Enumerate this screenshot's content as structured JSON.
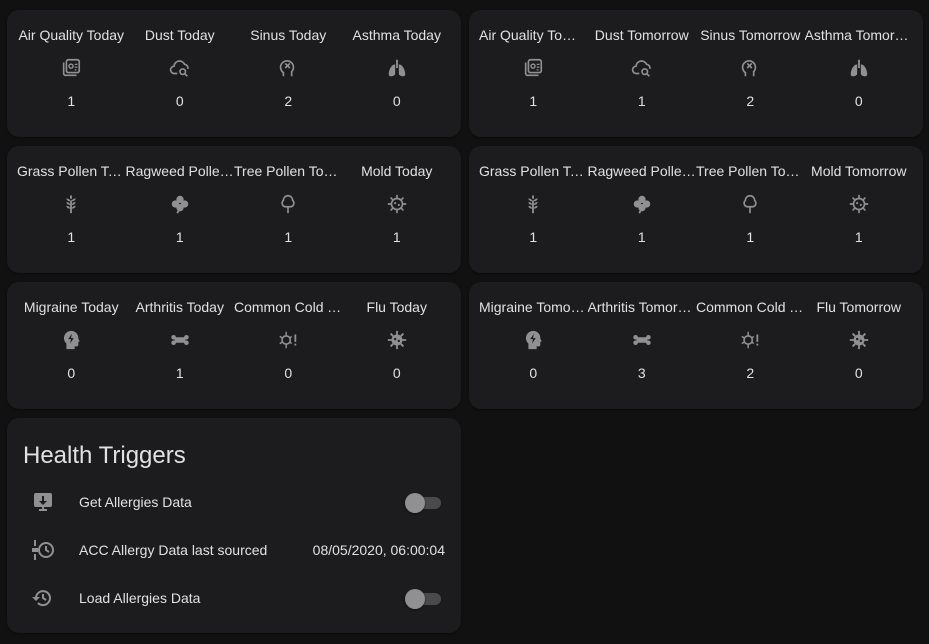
{
  "colors": {
    "background": "#111111",
    "card": "#1c1c1e",
    "text": "#e1e1e1",
    "icon": "#909092"
  },
  "glance_cards": [
    {
      "entities": [
        {
          "name": "Air Quality Today",
          "icon": "air-quality-icon",
          "value": "1"
        },
        {
          "name": "Dust Today",
          "icon": "cloud-search-icon",
          "value": "0"
        },
        {
          "name": "Sinus Today",
          "icon": "head-remove-icon",
          "value": "2"
        },
        {
          "name": "Asthma Today",
          "icon": "lungs-icon",
          "value": "0"
        }
      ]
    },
    {
      "entities": [
        {
          "name": "Air Quality Tomorrow",
          "icon": "air-quality-icon",
          "value": "1"
        },
        {
          "name": "Dust Tomorrow",
          "icon": "cloud-search-icon",
          "value": "1"
        },
        {
          "name": "Sinus Tomorrow",
          "icon": "head-remove-icon",
          "value": "2"
        },
        {
          "name": "Asthma Tomorrow",
          "icon": "lungs-icon",
          "value": "0"
        }
      ]
    },
    {
      "entities": [
        {
          "name": "Grass Pollen Today",
          "icon": "grain-icon",
          "value": "1"
        },
        {
          "name": "Ragweed Pollen Today",
          "icon": "clover-icon",
          "value": "1"
        },
        {
          "name": "Tree Pollen Today",
          "icon": "tree-outline-icon",
          "value": "1"
        },
        {
          "name": "Mold Today",
          "icon": "virus-outline-icon",
          "value": "1"
        }
      ]
    },
    {
      "entities": [
        {
          "name": "Grass Pollen Tomorrow",
          "icon": "grain-icon",
          "value": "1"
        },
        {
          "name": "Ragweed Pollen Tomorrow",
          "icon": "clover-icon",
          "value": "1"
        },
        {
          "name": "Tree Pollen Tomorrow",
          "icon": "tree-outline-icon",
          "value": "1"
        },
        {
          "name": "Mold Tomorrow",
          "icon": "virus-outline-icon",
          "value": "1"
        }
      ]
    },
    {
      "entities": [
        {
          "name": "Migraine Today",
          "icon": "head-flash-icon",
          "value": "0"
        },
        {
          "name": "Arthritis Today",
          "icon": "bone-icon",
          "value": "1"
        },
        {
          "name": "Common Cold Today",
          "icon": "bacteria-alert-icon",
          "value": "0"
        },
        {
          "name": "Flu Today",
          "icon": "virus-icon",
          "value": "0"
        }
      ]
    },
    {
      "entities": [
        {
          "name": "Migraine Tomorrow",
          "icon": "head-flash-icon",
          "value": "0"
        },
        {
          "name": "Arthritis Tomorrow",
          "icon": "bone-icon",
          "value": "3"
        },
        {
          "name": "Common Cold Tomorrow",
          "icon": "bacteria-alert-icon",
          "value": "2"
        },
        {
          "name": "Flu Tomorrow",
          "icon": "virus-icon",
          "value": "0"
        }
      ]
    }
  ],
  "triggers": {
    "title": "Health Triggers",
    "rows": [
      {
        "label": "Get Allergies Data",
        "icon": "download-box-icon",
        "type": "toggle",
        "state": "off"
      },
      {
        "label": "ACC Allergy Data last sourced",
        "icon": "timeline-clock-icon",
        "type": "text",
        "state": "08/05/2020, 06:00:04"
      },
      {
        "label": "Load Allergies Data",
        "icon": "restore-clock-icon",
        "type": "toggle",
        "state": "off"
      }
    ]
  }
}
